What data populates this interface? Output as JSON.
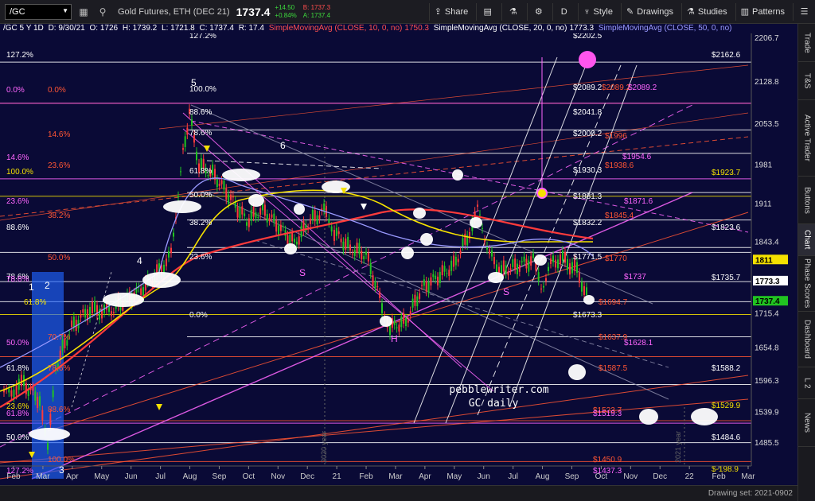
{
  "toolbar": {
    "symbol": "/GC",
    "title": "Gold Futures, ETH (DEC 21)",
    "price": "1737.4",
    "change": "+14.50",
    "change_pct": "+0.84%",
    "bid": "B: 1737.3",
    "ask": "A: 1737.4",
    "share_label": "Share",
    "period_label": "D",
    "style_label": "Style",
    "drawings_label": "Drawings",
    "studies_label": "Studies",
    "patterns_label": "Patterns"
  },
  "info": {
    "header": "/GC 5 Y 1D",
    "date": "D: 9/30/21",
    "open": "O: 1726",
    "high": "H: 1739.2",
    "low": "L: 1721.8",
    "close": "C: 1737.4",
    "range": "R: 17.4",
    "sma10_label": "SimpleMovingAvg (CLOSE, 10, 0, no)",
    "sma10_value": "1750.3",
    "sma20_label": "SimpleMovingAvg (CLOSE, 20, 0, no)",
    "sma20_value": "1773.3",
    "sma50_label": "SimpleMovingAvg (CLOSE, 50, 0, no)"
  },
  "right_rail": [
    "Trade",
    "T&S",
    "Active Trader",
    "Buttons",
    "Chart",
    "Phase Scores",
    "Dashboard",
    "L 2",
    "News"
  ],
  "price_axis": {
    "ticks": [
      "2206.7",
      "2128.8",
      "2053.5",
      "1981",
      "1911",
      "1843.4",
      "1773.3",
      "1715.4",
      "1654.8",
      "1596.3",
      "1539.9",
      "1485.5"
    ],
    "tags": [
      {
        "label": "1811",
        "color": "#f5e100",
        "text_color": "#000"
      },
      {
        "label": "1773.3",
        "color": "#ffffff",
        "text_color": "#000"
      },
      {
        "label": "1737.4",
        "color": "#21c421",
        "text_color": "#000"
      }
    ]
  },
  "time_axis": {
    "labels": [
      "Feb",
      "Mar",
      "Apr",
      "May",
      "Jun",
      "Jul",
      "Aug",
      "Sep",
      "Oct",
      "Nov",
      "Dec",
      "21",
      "Feb",
      "Mar",
      "Apr",
      "May",
      "Jun",
      "Jul",
      "Aug",
      "Sep",
      "Oct",
      "Nov",
      "Dec",
      "22",
      "Feb",
      "Mar"
    ],
    "year_markers": [
      "2020 year",
      "2021 year"
    ]
  },
  "fib_labels": {
    "left": [
      {
        "text": "127.2%",
        "color": "#ffffff"
      },
      {
        "text": "0.0%",
        "color": "#ff66ff"
      },
      {
        "text": "0.0%",
        "color": "#ff5533"
      },
      {
        "text": "14.6%",
        "color": "#ff5533"
      },
      {
        "text": "14.6%",
        "color": "#ff66ff"
      },
      {
        "text": "23.6%",
        "color": "#ff5533"
      },
      {
        "text": "100.0%",
        "color": "#f5e100"
      },
      {
        "text": "23.6%",
        "color": "#ff66ff"
      },
      {
        "text": "38.2%",
        "color": "#ff5533"
      },
      {
        "text": "88.6%",
        "color": "#ffffff"
      },
      {
        "text": "50.0%",
        "color": "#ff5533"
      },
      {
        "text": "78.6%",
        "color": "#ffffff"
      },
      {
        "text": "78.6%",
        "color": "#ff66ff"
      },
      {
        "text": "61.8%",
        "color": "#f5e100"
      },
      {
        "text": "70.7%",
        "color": "#ff5533"
      },
      {
        "text": "50.0%",
        "color": "#ff66ff"
      },
      {
        "text": "61.8%",
        "color": "#ffffff"
      },
      {
        "text": "78.6%",
        "color": "#ff5533"
      },
      {
        "text": "23.6%",
        "color": "#f5e100"
      },
      {
        "text": "61.8%",
        "color": "#ff66ff"
      },
      {
        "text": "88.6%",
        "color": "#ff5533"
      },
      {
        "text": "50.0%",
        "color": "#ffffff"
      },
      {
        "text": "100.0%",
        "color": "#ff5533"
      },
      {
        "text": "127.2%",
        "color": "#ff66ff"
      }
    ],
    "mid": [
      {
        "text": "127.2%",
        "color": "#ffffff"
      },
      {
        "text": "100.0%",
        "color": "#ffffff"
      },
      {
        "text": "88.6%",
        "color": "#ffffff"
      },
      {
        "text": "78.6%",
        "color": "#ffffff"
      },
      {
        "text": "61.8%",
        "color": "#ffffff"
      },
      {
        "text": "50.0%",
        "color": "#ffffff"
      },
      {
        "text": "38.2%",
        "color": "#ffffff"
      },
      {
        "text": "23.6%",
        "color": "#ffffff"
      },
      {
        "text": "0.0%",
        "color": "#ffffff"
      }
    ]
  },
  "price_labels": [
    {
      "text": "$2202.5",
      "color": "#ffffff"
    },
    {
      "text": "$2162.6",
      "color": "#ffffff"
    },
    {
      "text": "$2089.2",
      "color": "#ffffff"
    },
    {
      "text": "$2089.2",
      "color": "#ff5533"
    },
    {
      "text": "$2089.2",
      "color": "#ff66ff"
    },
    {
      "text": "$2041.8",
      "color": "#ffffff"
    },
    {
      "text": "$2000.2",
      "color": "#ffffff"
    },
    {
      "text": "$1996",
      "color": "#ff5533"
    },
    {
      "text": "$1954.6",
      "color": "#ff66ff"
    },
    {
      "text": "$1938.6",
      "color": "#ff5533"
    },
    {
      "text": "$1930.3",
      "color": "#ffffff"
    },
    {
      "text": "$1923.7",
      "color": "#f5e100"
    },
    {
      "text": "$1881.3",
      "color": "#ffffff"
    },
    {
      "text": "$1871.6",
      "color": "#ff66ff"
    },
    {
      "text": "$1845.4",
      "color": "#ff5533"
    },
    {
      "text": "$1832.2",
      "color": "#ffffff"
    },
    {
      "text": "$1823.6",
      "color": "#ffffff"
    },
    {
      "text": "$1771.5",
      "color": "#ffffff"
    },
    {
      "text": "$1770",
      "color": "#ff5533"
    },
    {
      "text": "$1737",
      "color": "#ff66ff"
    },
    {
      "text": "$1735.7",
      "color": "#ffffff"
    },
    {
      "text": "$1694.7",
      "color": "#ff5533"
    },
    {
      "text": "$1673.3",
      "color": "#ffffff"
    },
    {
      "text": "$1637.9",
      "color": "#ff5533"
    },
    {
      "text": "$1628.1",
      "color": "#ff66ff"
    },
    {
      "text": "$1587.5",
      "color": "#ff5533"
    },
    {
      "text": "$1588.2",
      "color": "#ffffff"
    },
    {
      "text": "$1529.9",
      "color": "#f5e100"
    },
    {
      "text": "$1523.7",
      "color": "#ff5533"
    },
    {
      "text": "$1519.3",
      "color": "#ff66ff"
    },
    {
      "text": "$1484.6",
      "color": "#ffffff"
    },
    {
      "text": "$1450.9",
      "color": "#ff5533"
    },
    {
      "text": "$1437.3",
      "color": "#ff66ff"
    },
    {
      "text": "$-198.9",
      "color": "#f5e100"
    }
  ],
  "wave_labels": [
    "1",
    "2",
    "3",
    "4",
    "5",
    "6"
  ],
  "pattern_labels": [
    "S",
    "H",
    "S"
  ],
  "watermark": {
    "line1": "pebblewriter.com",
    "line2": "GC daily"
  },
  "status": {
    "drawing_set": "Drawing set: 2021-0902"
  },
  "colors": {
    "background": "#0a0a36",
    "sma10": "#ff4040",
    "sma20": "#f5e100",
    "sma50": "#9a9aff",
    "fib_white": "#ffffff",
    "fib_pink": "#ff66ff",
    "fib_red": "#ff5533"
  }
}
